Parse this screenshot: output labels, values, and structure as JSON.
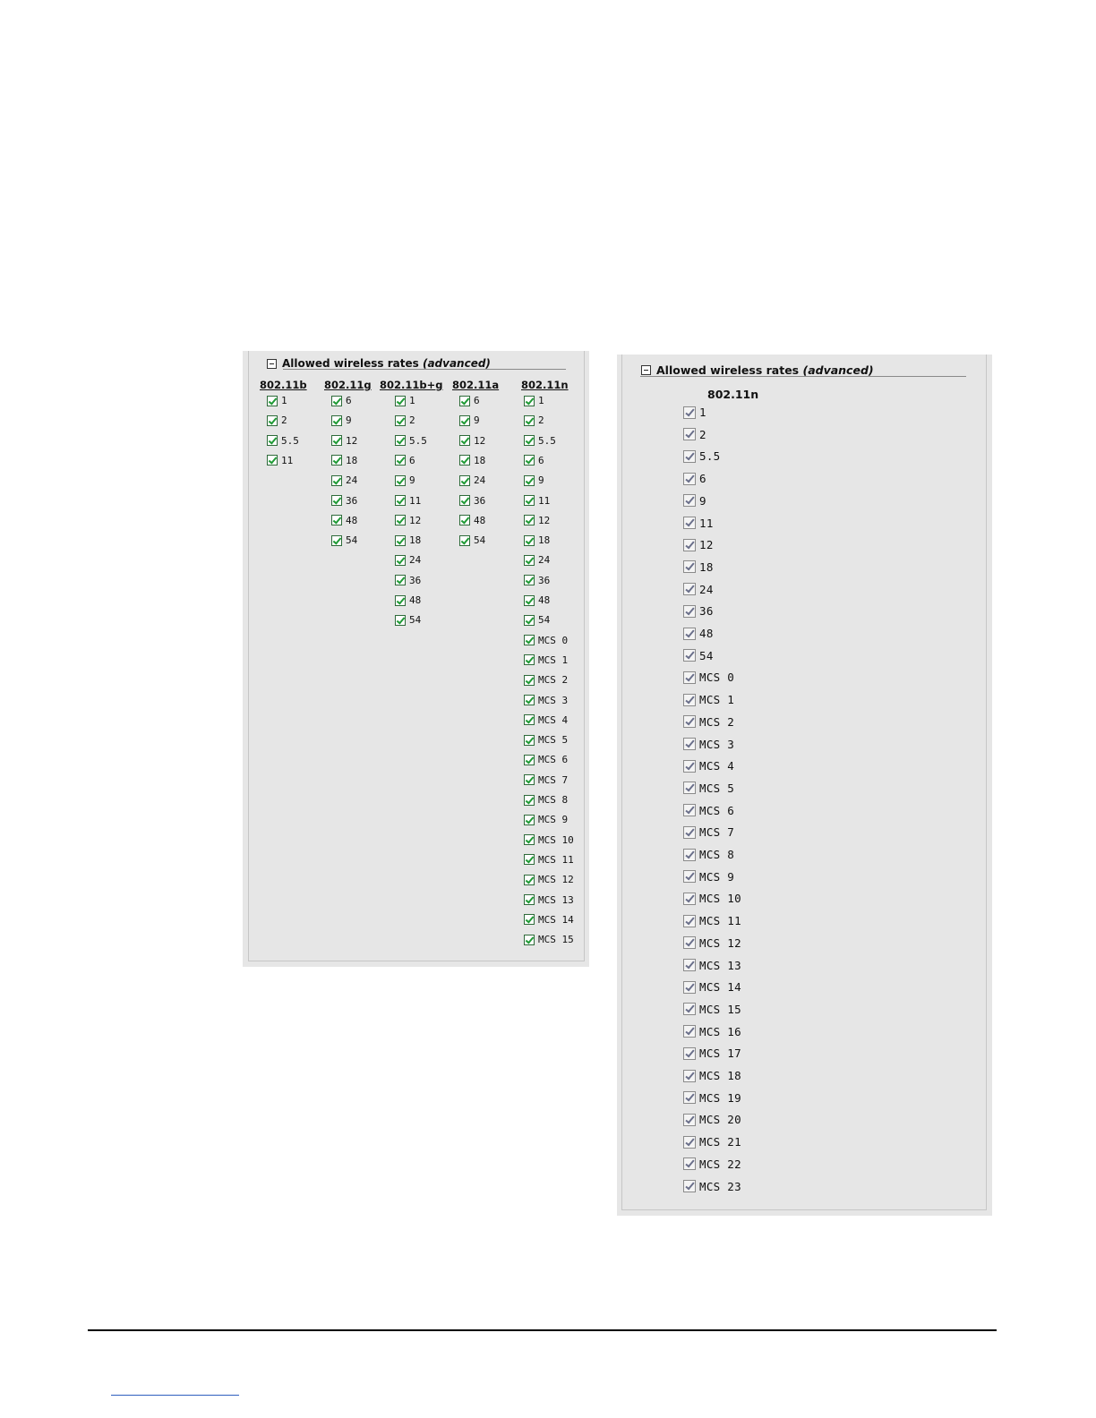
{
  "left_panel": {
    "legend_title": "Allowed wireless rates",
    "legend_suffix": "(advanced)",
    "columns": [
      {
        "header": "802.11b",
        "rates": [
          "1",
          "2",
          "5.5",
          "11"
        ]
      },
      {
        "header": "802.11g",
        "rates": [
          "6",
          "9",
          "12",
          "18",
          "24",
          "36",
          "48",
          "54"
        ]
      },
      {
        "header": "802.11b+g",
        "rates": [
          "1",
          "2",
          "5.5",
          "6",
          "9",
          "11",
          "12",
          "18",
          "24",
          "36",
          "48",
          "54"
        ]
      },
      {
        "header": "802.11a",
        "rates": [
          "6",
          "9",
          "12",
          "18",
          "24",
          "36",
          "48",
          "54"
        ]
      },
      {
        "header": "802.11n",
        "rates": [
          "1",
          "2",
          "5.5",
          "6",
          "9",
          "11",
          "12",
          "18",
          "24",
          "36",
          "48",
          "54",
          "MCS 0",
          "MCS 1",
          "MCS 2",
          "MCS 3",
          "MCS 4",
          "MCS 5",
          "MCS 6",
          "MCS 7",
          "MCS 8",
          "MCS 9",
          "MCS 10",
          "MCS 11",
          "MCS 12",
          "MCS 13",
          "MCS 14",
          "MCS 15"
        ]
      }
    ]
  },
  "right_panel": {
    "legend_title": "Allowed wireless rates",
    "legend_suffix": "(advanced)",
    "column": {
      "header": "802.11n",
      "rates": [
        "1",
        "2",
        "5.5",
        "6",
        "9",
        "11",
        "12",
        "18",
        "24",
        "36",
        "48",
        "54",
        "MCS 0",
        "MCS 1",
        "MCS 2",
        "MCS 3",
        "MCS 4",
        "MCS 5",
        "MCS 6",
        "MCS 7",
        "MCS 8",
        "MCS 9",
        "MCS 10",
        "MCS 11",
        "MCS 12",
        "MCS 13",
        "MCS 14",
        "MCS 15",
        "MCS 16",
        "MCS 17",
        "MCS 18",
        "MCS 19",
        "MCS 20",
        "MCS 21",
        "MCS 22",
        "MCS 23"
      ]
    }
  }
}
